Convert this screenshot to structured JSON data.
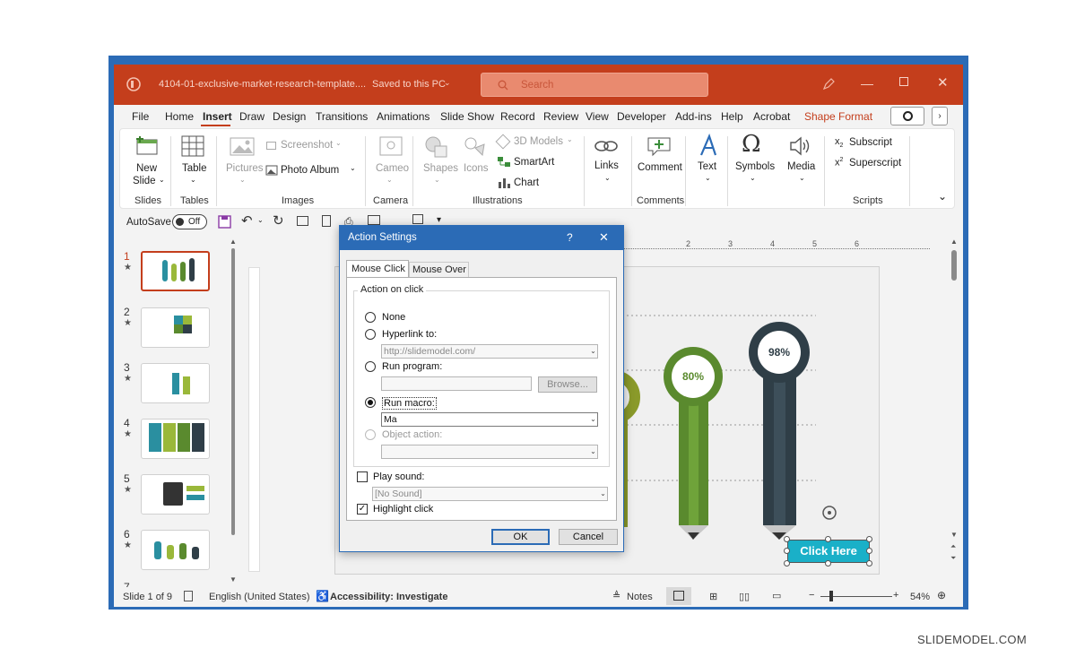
{
  "window": {
    "filename": "4104-01-exclusive-market-research-template....",
    "save_status": "Saved to this PC",
    "search_placeholder": "Search"
  },
  "tabs": [
    "File",
    "Home",
    "Insert",
    "Draw",
    "Design",
    "Transitions",
    "Animations",
    "Slide Show",
    "Record",
    "Review",
    "View",
    "Developer",
    "Add-ins",
    "Help",
    "Acrobat",
    "Shape Format"
  ],
  "active_tab": "Insert",
  "ribbon": {
    "new_slide": [
      "New",
      "Slide"
    ],
    "table": "Table",
    "pictures": "Pictures",
    "screenshot": "Screenshot",
    "photo_album": "Photo Album",
    "cameo": "Cameo",
    "shapes": "Shapes",
    "icons": "Icons",
    "models_3d": "3D Models",
    "smartart": "SmartArt",
    "chart": "Chart",
    "links": "Links",
    "comment": "Comment",
    "text": "Text",
    "symbols": "Symbols",
    "media": "Media",
    "subscript": "Subscript",
    "superscript": "Superscript",
    "groups": {
      "slides": "Slides",
      "tables": "Tables",
      "images": "Images",
      "camera": "Camera",
      "illustrations": "Illustrations",
      "comments": "Comments",
      "scripts": "Scripts"
    }
  },
  "qat": {
    "autosave_label": "AutoSave",
    "autosave_state": "Off"
  },
  "thumbnails": [
    {
      "num": "1",
      "star": "★"
    },
    {
      "num": "2",
      "star": "★"
    },
    {
      "num": "3",
      "star": "★"
    },
    {
      "num": "4",
      "star": "★"
    },
    {
      "num": "5",
      "star": "★"
    },
    {
      "num": "6",
      "star": "★"
    },
    {
      "num": "7",
      "star": ""
    }
  ],
  "ruler": {
    "ticks": [
      "2",
      "3",
      "4",
      "5",
      "6"
    ]
  },
  "slide": {
    "pct_80": "80%",
    "pct_98": "98%",
    "click_here": "Click Here"
  },
  "dialog": {
    "title": "Action Settings",
    "help": "?",
    "close": "✕",
    "tab_mouse_click": "Mouse Click",
    "tab_mouse_over": "Mouse Over",
    "group_label": "Action on click",
    "none": "None",
    "hyperlink_to": "Hyperlink to:",
    "hyperlink_value": "http://slidemodel.com/",
    "run_program": "Run program:",
    "browse": "Browse...",
    "run_macro": "Run macro:",
    "macro_value": "Ma",
    "object_action": "Object action:",
    "play_sound": "Play sound:",
    "sound_value": "[No Sound]",
    "highlight_click": "Highlight click",
    "ok": "OK",
    "cancel": "Cancel",
    "selected_action": "Run macro",
    "play_sound_checked": false,
    "highlight_click_checked": true
  },
  "status": {
    "slide_of": "Slide 1 of 9",
    "language": "English (United States)",
    "accessibility": "Accessibility: Investigate",
    "notes": "Notes",
    "zoom_out": "−",
    "zoom_in": "+",
    "zoom": "54%"
  },
  "watermark": "SLIDEMODEL.COM",
  "colors": {
    "titlebar": "#c43e1c",
    "frame": "#2b6bb6",
    "accent_cyan": "#1ab0c8",
    "bar_green": "#5a8a2e",
    "bar_dark": "#2f3e47"
  }
}
